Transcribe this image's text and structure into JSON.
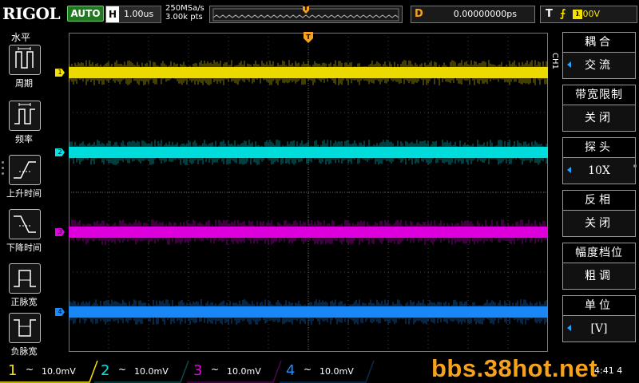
{
  "header": {
    "logo": "RIGOL",
    "run_mode": "AUTO",
    "horizontal": {
      "label": "H",
      "timebase": "1.00us"
    },
    "sample_rate": "250MSa/s",
    "memory_depth": "3.00k pts",
    "trigger_marker": "T",
    "delay": {
      "label": "D",
      "value": "0.00000000ps"
    },
    "trigger": {
      "label": "T",
      "source": "1",
      "level": "0.00V"
    }
  },
  "left_menu": {
    "title": "水平",
    "items": [
      {
        "label": "周期",
        "icon": "period-icon"
      },
      {
        "label": "频率",
        "icon": "frequency-icon"
      },
      {
        "label": "上升时间",
        "icon": "rise-time-icon"
      },
      {
        "label": "下降时间",
        "icon": "fall-time-icon"
      },
      {
        "label": "正脉宽",
        "icon": "positive-width-icon"
      },
      {
        "label": "负脉宽",
        "icon": "negative-width-icon"
      }
    ]
  },
  "right_menu": {
    "channel_tag": "CH1",
    "items": [
      {
        "title": "耦合",
        "value": "交流",
        "has_arrow": true
      },
      {
        "title": "带宽限制",
        "value": "关闭",
        "has_arrow": false
      },
      {
        "title": "探头",
        "value": "10X",
        "has_arrow": true
      },
      {
        "title": "反相",
        "value": "关闭",
        "has_arrow": false
      },
      {
        "title": "幅度档位",
        "value": "粗调",
        "has_arrow": false
      },
      {
        "title": "单位",
        "value": "[V]",
        "has_arrow": true
      }
    ]
  },
  "channels": [
    {
      "num": "1",
      "coupling": "~",
      "scale": "10.0mV",
      "color": "#f6e200",
      "active": true
    },
    {
      "num": "2",
      "coupling": "~",
      "scale": "10.0mV",
      "color": "#00e5e5",
      "active": false
    },
    {
      "num": "3",
      "coupling": "~",
      "scale": "10.0mV",
      "color": "#e600e6",
      "active": false
    },
    {
      "num": "4",
      "coupling": "~",
      "scale": "10.0mV",
      "color": "#1a8cff",
      "active": false
    }
  ],
  "traces": [
    {
      "channel": "1",
      "level_div": 3.0,
      "color": "#f6e200"
    },
    {
      "channel": "2",
      "level_div": 1.0,
      "color": "#00e5e5"
    },
    {
      "channel": "3",
      "level_div": -1.0,
      "color": "#e600e6"
    },
    {
      "channel": "4",
      "level_div": -3.0,
      "color": "#1a8cff"
    }
  ],
  "watermark": "bbs.38hot.net",
  "corner_text": "4:41 4"
}
